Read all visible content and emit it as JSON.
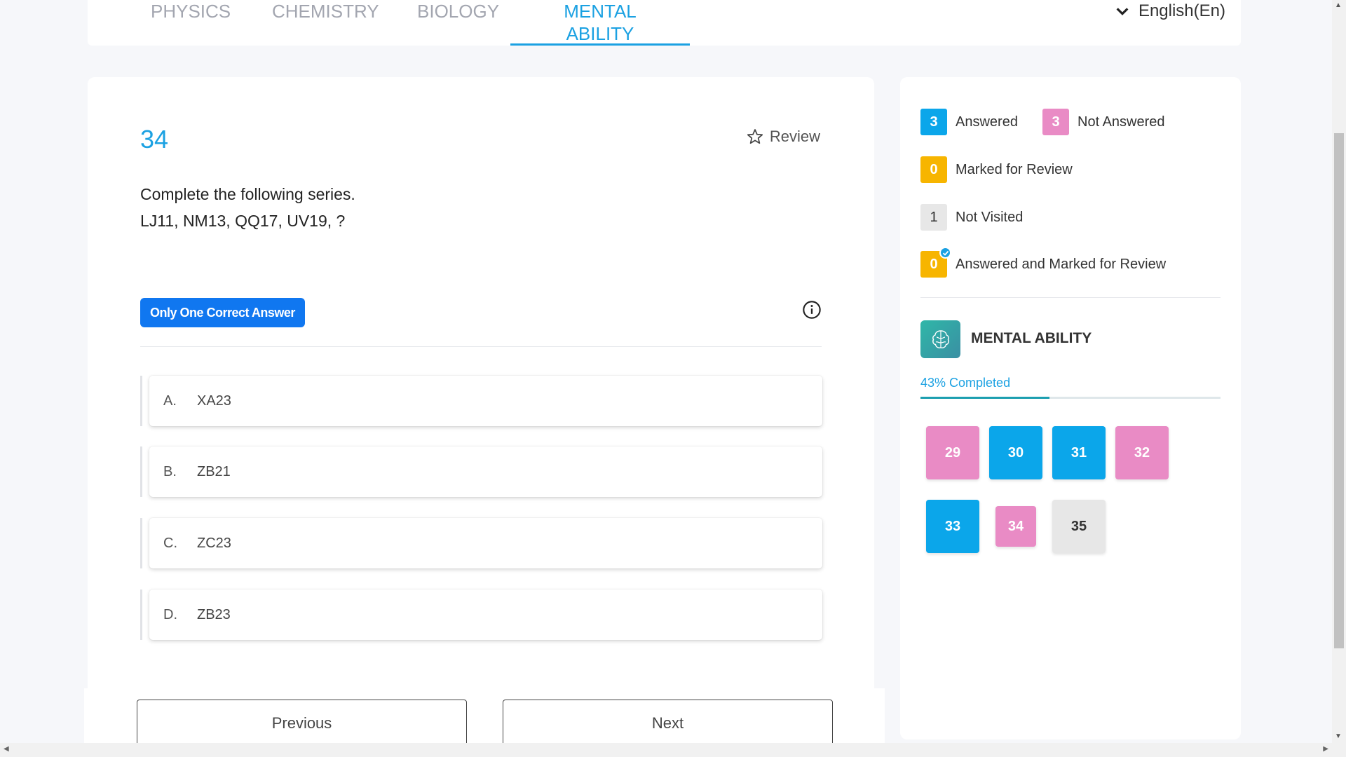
{
  "tabs": [
    {
      "label": "PHYSICS"
    },
    {
      "label": "CHEMISTRY"
    },
    {
      "label": "BIOLOGY"
    },
    {
      "label": "MENTAL ABILITY"
    }
  ],
  "active_tab": "MENTAL ABILITY",
  "language": {
    "label": "English(En)"
  },
  "question": {
    "number": "34",
    "review_label": "Review",
    "line1": "Complete the following series.",
    "line2": "LJ11, NM13, QQ17, UV19, ?",
    "answer_type": "Only One Correct Answer",
    "options": [
      {
        "letter": "A.",
        "text": "XA23"
      },
      {
        "letter": "B.",
        "text": "ZB21"
      },
      {
        "letter": "C.",
        "text": "ZC23"
      },
      {
        "letter": "D.",
        "text": "ZB23"
      }
    ]
  },
  "footer": {
    "previous_label": "Previous",
    "next_label": "Next"
  },
  "legend": {
    "answered": {
      "count": "3",
      "label": "Answered",
      "color": "#0ba6ea"
    },
    "not_answered": {
      "count": "3",
      "label": "Not Answered",
      "color": "#e98bc5"
    },
    "marked_review": {
      "count": "0",
      "label": "Marked for Review",
      "color": "#f7b500"
    },
    "not_visited": {
      "count": "1",
      "label": "Not Visited",
      "color": "#e7e7e7"
    },
    "answered_marked": {
      "count": "0",
      "label": "Answered and Marked for Review",
      "color": "#f7b500"
    }
  },
  "subject": {
    "name": "MENTAL ABILITY",
    "progress_label": "43% Completed",
    "progress_fraction": 0.43
  },
  "question_palette": [
    {
      "num": "29",
      "status": "not-answered"
    },
    {
      "num": "30",
      "status": "answered"
    },
    {
      "num": "31",
      "status": "answered"
    },
    {
      "num": "32",
      "status": "not-answered"
    },
    {
      "num": "33",
      "status": "answered"
    },
    {
      "num": "34",
      "status": "not-answered"
    },
    {
      "num": "35",
      "status": "not-visited"
    }
  ]
}
